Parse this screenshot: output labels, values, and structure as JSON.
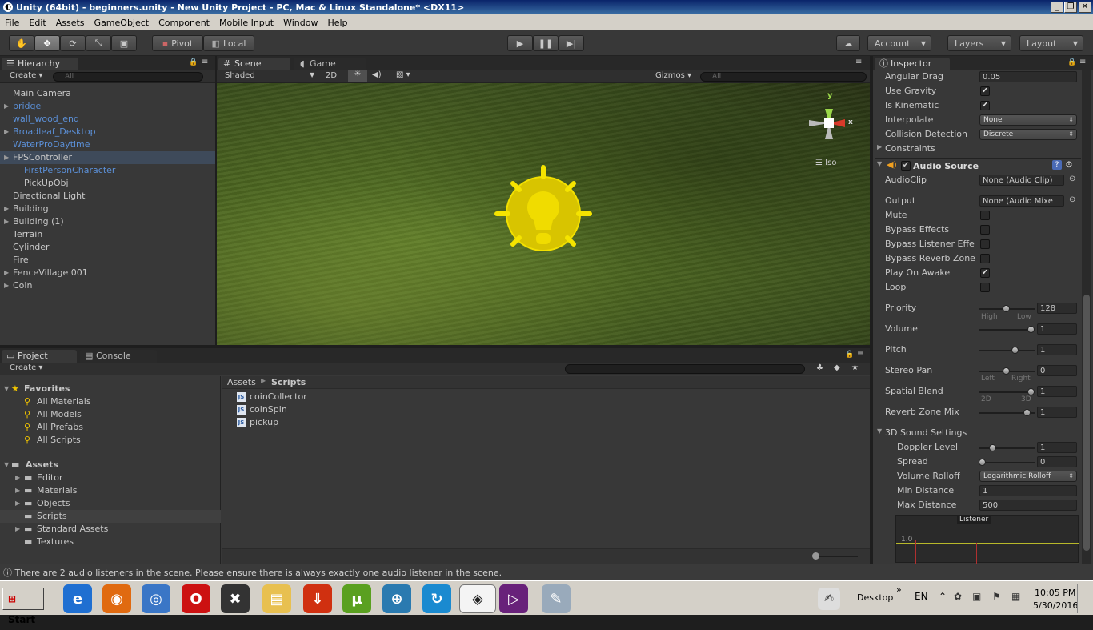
{
  "window": {
    "title": "Unity (64bit) - beginners.unity - New Unity Project - PC, Mac & Linux Standalone* <DX11>"
  },
  "menu": [
    "File",
    "Edit",
    "Assets",
    "GameObject",
    "Component",
    "Mobile Input",
    "Window",
    "Help"
  ],
  "toolbar": {
    "pivot": "Pivot",
    "local": "Local",
    "account": "Account",
    "layers": "Layers",
    "layout": "Layout"
  },
  "hierarchy": {
    "tab": "Hierarchy",
    "create": "Create",
    "search_placeholder": "All",
    "items": [
      {
        "label": "Main Camera",
        "blue": false,
        "expandable": false,
        "indent": 0
      },
      {
        "label": "bridge",
        "blue": true,
        "expandable": true,
        "indent": 0
      },
      {
        "label": "wall_wood_end",
        "blue": true,
        "expandable": false,
        "indent": 0
      },
      {
        "label": "Broadleaf_Desktop",
        "blue": true,
        "expandable": true,
        "indent": 0
      },
      {
        "label": "WaterProDaytime",
        "blue": true,
        "expandable": false,
        "indent": 0
      },
      {
        "label": "FPSController",
        "blue": false,
        "expandable": true,
        "indent": 0,
        "selected": true
      },
      {
        "label": "FirstPersonCharacter",
        "blue": true,
        "expandable": false,
        "indent": 1
      },
      {
        "label": "PickUpObj",
        "blue": false,
        "expandable": false,
        "indent": 1
      },
      {
        "label": "Directional Light",
        "blue": false,
        "expandable": false,
        "indent": 0
      },
      {
        "label": "Building",
        "blue": false,
        "expandable": true,
        "indent": 0
      },
      {
        "label": "Building (1)",
        "blue": false,
        "expandable": true,
        "indent": 0
      },
      {
        "label": "Terrain",
        "blue": false,
        "expandable": false,
        "indent": 0
      },
      {
        "label": "Cylinder",
        "blue": false,
        "expandable": false,
        "indent": 0
      },
      {
        "label": "Fire",
        "blue": false,
        "expandable": false,
        "indent": 0
      },
      {
        "label": "FenceVillage 001",
        "blue": false,
        "expandable": true,
        "indent": 0
      },
      {
        "label": "Coin",
        "blue": false,
        "expandable": true,
        "indent": 0
      }
    ]
  },
  "scene": {
    "tab_scene": "Scene",
    "tab_game": "Game",
    "shaded": "Shaded",
    "mode_2d": "2D",
    "gizmos": "Gizmos",
    "search_placeholder": "All",
    "iso": "Iso",
    "axis_y": "y",
    "axis_x": "x"
  },
  "project": {
    "tab_project": "Project",
    "tab_console": "Console",
    "create": "Create",
    "favorites_label": "Favorites",
    "favorites": [
      "All Materials",
      "All Models",
      "All Prefabs",
      "All Scripts"
    ],
    "assets_label": "Assets",
    "folders": [
      {
        "label": "Editor",
        "expandable": true
      },
      {
        "label": "Materials",
        "expandable": true
      },
      {
        "label": "Objects",
        "expandable": true
      },
      {
        "label": "Scripts",
        "expandable": false,
        "selected": true
      },
      {
        "label": "Standard Assets",
        "expandable": true
      },
      {
        "label": "Textures",
        "expandable": false
      }
    ],
    "breadcrumb_root": "Assets",
    "breadcrumb_current": "Scripts",
    "files": [
      "coinCollector",
      "coinSpin",
      "pickup"
    ]
  },
  "inspector": {
    "tab": "Inspector",
    "angular_drag_label": "Angular Drag",
    "angular_drag": "0.05",
    "use_gravity_label": "Use Gravity",
    "use_gravity": true,
    "is_kinematic_label": "Is Kinematic",
    "is_kinematic": true,
    "interpolate_label": "Interpolate",
    "interpolate": "None",
    "collision_detection_label": "Collision Detection",
    "collision_detection": "Discrete",
    "constraints_label": "Constraints",
    "audio_source_label": "Audio Source",
    "audioclip_label": "AudioClip",
    "audioclip": "None (Audio Clip)",
    "output_label": "Output",
    "output": "None (Audio Mixe",
    "mute_label": "Mute",
    "bypass_effects_label": "Bypass Effects",
    "bypass_listener_label": "Bypass Listener Effe",
    "bypass_reverb_label": "Bypass Reverb Zone",
    "play_on_awake_label": "Play On Awake",
    "play_on_awake": true,
    "loop_label": "Loop",
    "priority_label": "Priority",
    "priority": "128",
    "priority_high": "High",
    "priority_low": "Low",
    "volume_label": "Volume",
    "volume": "1",
    "pitch_label": "Pitch",
    "pitch": "1",
    "stereo_pan_label": "Stereo Pan",
    "stereo_pan": "0",
    "stereo_left": "Left",
    "stereo_right": "Right",
    "spatial_blend_label": "Spatial Blend",
    "spatial_blend": "1",
    "spatial_2d": "2D",
    "spatial_3d": "3D",
    "reverb_mix_label": "Reverb Zone Mix",
    "reverb_mix": "1",
    "sound3d_label": "3D Sound Settings",
    "doppler_label": "Doppler Level",
    "doppler": "1",
    "spread_label": "Spread",
    "spread": "0",
    "rolloff_label": "Volume Rolloff",
    "rolloff": "Logarithmic Rolloff",
    "min_distance_label": "Min Distance",
    "min_distance": "1",
    "max_distance_label": "Max Distance",
    "max_distance": "500",
    "listener_label": "Listener",
    "graph_tick": "1.0"
  },
  "status": {
    "message": "There are 2 audio listeners in the scene. Please ensure there is always exactly one audio listener in the scene."
  },
  "taskbar": {
    "start": "Start",
    "desktop": "Desktop",
    "lang": "EN",
    "time": "10:05 PM",
    "date": "5/30/2016"
  },
  "colors": {
    "accent": "#5b8fd6",
    "bulb": "#e6cf00"
  }
}
